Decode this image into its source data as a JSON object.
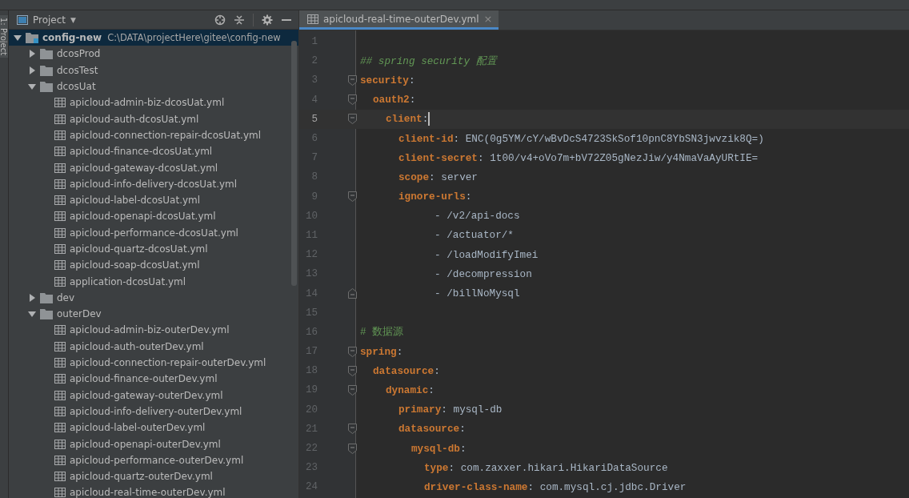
{
  "tool_strip": {
    "label": "1: Project"
  },
  "project_panel": {
    "title": "Project",
    "caret": "▼",
    "tree": [
      {
        "name": "config-new",
        "path": "C:\\DATA\\projectHere\\gitee\\config-new",
        "kind": "module",
        "expanded": true,
        "selected": true,
        "children": [
          {
            "name": "dcosProd",
            "kind": "folder",
            "expanded": false,
            "selected": false
          },
          {
            "name": "dcosTest",
            "kind": "folder",
            "expanded": false,
            "selected": false
          },
          {
            "name": "dcosUat",
            "kind": "folder",
            "expanded": true,
            "selected": false,
            "children": [
              {
                "name": "apicloud-admin-biz-dcosUat.yml",
                "kind": "file",
                "selected": false
              },
              {
                "name": "apicloud-auth-dcosUat.yml",
                "kind": "file",
                "selected": false
              },
              {
                "name": "apicloud-connection-repair-dcosUat.yml",
                "kind": "file",
                "selected": false
              },
              {
                "name": "apicloud-finance-dcosUat.yml",
                "kind": "file",
                "selected": false
              },
              {
                "name": "apicloud-gateway-dcosUat.yml",
                "kind": "file",
                "selected": false
              },
              {
                "name": "apicloud-info-delivery-dcosUat.yml",
                "kind": "file",
                "selected": false
              },
              {
                "name": "apicloud-label-dcosUat.yml",
                "kind": "file",
                "selected": false
              },
              {
                "name": "apicloud-openapi-dcosUat.yml",
                "kind": "file",
                "selected": false
              },
              {
                "name": "apicloud-performance-dcosUat.yml",
                "kind": "file",
                "selected": false
              },
              {
                "name": "apicloud-quartz-dcosUat.yml",
                "kind": "file",
                "selected": false
              },
              {
                "name": "apicloud-soap-dcosUat.yml",
                "kind": "file",
                "selected": false
              },
              {
                "name": "application-dcosUat.yml",
                "kind": "file",
                "selected": false
              }
            ]
          },
          {
            "name": "dev",
            "kind": "folder",
            "expanded": false,
            "selected": false
          },
          {
            "name": "outerDev",
            "kind": "folder",
            "expanded": true,
            "selected": false,
            "children": [
              {
                "name": "apicloud-admin-biz-outerDev.yml",
                "kind": "file",
                "selected": false
              },
              {
                "name": "apicloud-auth-outerDev.yml",
                "kind": "file",
                "selected": false
              },
              {
                "name": "apicloud-connection-repair-outerDev.yml",
                "kind": "file",
                "selected": false
              },
              {
                "name": "apicloud-finance-outerDev.yml",
                "kind": "file",
                "selected": false
              },
              {
                "name": "apicloud-gateway-outerDev.yml",
                "kind": "file",
                "selected": false
              },
              {
                "name": "apicloud-info-delivery-outerDev.yml",
                "kind": "file",
                "selected": false
              },
              {
                "name": "apicloud-label-outerDev.yml",
                "kind": "file",
                "selected": false
              },
              {
                "name": "apicloud-openapi-outerDev.yml",
                "kind": "file",
                "selected": false
              },
              {
                "name": "apicloud-performance-outerDev.yml",
                "kind": "file",
                "selected": false
              },
              {
                "name": "apicloud-quartz-outerDev.yml",
                "kind": "file",
                "selected": false
              },
              {
                "name": "apicloud-real-time-outerDev.yml",
                "kind": "file",
                "selected": false
              }
            ]
          }
        ]
      }
    ]
  },
  "editor": {
    "tabs": [
      {
        "label": "apicloud-real-time-outerDev.yml",
        "close": "×",
        "selected": true
      }
    ],
    "lines": [
      {
        "number": "1",
        "kind": "blank"
      },
      {
        "number": "2",
        "kind": "comment",
        "text": "## spring security 配置",
        "italic": true
      },
      {
        "number": "3",
        "kind": "key",
        "key": "security",
        "colon": ":",
        "fold_start": true,
        "children": [
          {
            "number": "4",
            "kind": "key",
            "key": "oauth2",
            "colon": ":",
            "fold_start": true,
            "children": [
              {
                "number": "5",
                "kind": "key",
                "key": "client",
                "colon": ":",
                "fold_start": true,
                "current": true,
                "children": [
                  {
                    "number": "6",
                    "kind": "key",
                    "key": "client-id",
                    "colon": ":",
                    "value": "ENC(0g5YM/cY/wBvDcS4723SkSof10pnC8YbSN3jwvzik8Q=)"
                  },
                  {
                    "number": "7",
                    "kind": "key",
                    "key": "client-secret",
                    "colon": ":",
                    "value": "1t00/v4+oVo7m+bV72Z05gNezJiw/y4NmaVaAyURtIE="
                  },
                  {
                    "number": "8",
                    "kind": "key",
                    "key": "scope",
                    "colon": ":",
                    "value": "server"
                  },
                  {
                    "number": "9",
                    "kind": "key",
                    "key": "ignore-urls",
                    "colon": ":",
                    "fold_start": true,
                    "children": [
                      {
                        "number": "10",
                        "kind": "item",
                        "text": "- /v2/api-docs"
                      },
                      {
                        "number": "11",
                        "kind": "item",
                        "text": "- /actuator/*"
                      },
                      {
                        "number": "12",
                        "kind": "item",
                        "text": "- /loadModifyImei"
                      },
                      {
                        "number": "13",
                        "kind": "item",
                        "text": "- /decompression"
                      },
                      {
                        "number": "14",
                        "kind": "item",
                        "text": "- /billNoMysql",
                        "fold_end": true
                      }
                    ]
                  }
                ]
              }
            ]
          }
        ]
      },
      {
        "number": "15",
        "kind": "blank"
      },
      {
        "number": "16",
        "kind": "comment",
        "text": "# 数据源",
        "italic": false
      },
      {
        "number": "17",
        "kind": "key",
        "key": "spring",
        "colon": ":",
        "fold_start": true,
        "children": [
          {
            "number": "18",
            "kind": "key",
            "key": "datasource",
            "colon": ":",
            "fold_start": true,
            "children": [
              {
                "number": "19",
                "kind": "key",
                "key": "dynamic",
                "colon": ":",
                "fold_start": true,
                "children": [
                  {
                    "number": "20",
                    "kind": "key",
                    "key": "primary",
                    "colon": ":",
                    "value": "mysql-db"
                  },
                  {
                    "number": "21",
                    "kind": "key",
                    "key": "datasource",
                    "colon": ":",
                    "fold_start": true,
                    "children": [
                      {
                        "number": "22",
                        "kind": "key",
                        "key": "mysql-db",
                        "colon": ":",
                        "fold_start": true,
                        "children": [
                          {
                            "number": "23",
                            "kind": "key",
                            "key": "type",
                            "colon": ":",
                            "value": "com.zaxxer.hikari.HikariDataSource"
                          },
                          {
                            "number": "24",
                            "kind": "key",
                            "key": "driver-class-name",
                            "colon": ":",
                            "value": "com.mysql.cj.jdbc.Driver"
                          }
                        ]
                      }
                    ]
                  }
                ]
              }
            ]
          }
        ]
      }
    ]
  }
}
